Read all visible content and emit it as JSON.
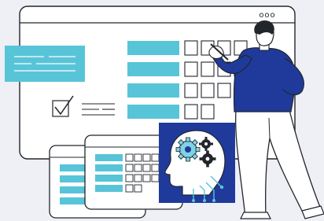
{
  "illustration": {
    "title_dots": "ooo",
    "colors": {
      "background": "#eef0f6",
      "window": "#ffffff",
      "outline": "#22252b",
      "accent_cyan": "#58c4d8",
      "navy": "#1f3a9a",
      "brain_panel": "#1f3a9a",
      "brain_gear_outer": "#7fd2e6",
      "brain_gear_inner": "#22252b",
      "skin": "#ffffff",
      "hair": "#22252b"
    },
    "main_window": {
      "rows": [
        {
          "filled_bar": true,
          "checkboxes": 4
        },
        {
          "filled_bar": true,
          "checkboxes": 4
        },
        {
          "filled_bar": true,
          "checkboxes": 4
        },
        {
          "filled_bar": true,
          "checkboxes": 2
        }
      ]
    },
    "sticky_note": {
      "lines": 3
    },
    "checklist_icon": {
      "name": "checkbox-tick-icon",
      "lines": 2
    },
    "small_window_back": {
      "rows": 4
    },
    "small_window_front": {
      "rows": 4
    },
    "brain_panel": {
      "icon": "ai-brain-gears-icon"
    },
    "person": {
      "icon": "person-writing-icon"
    }
  }
}
